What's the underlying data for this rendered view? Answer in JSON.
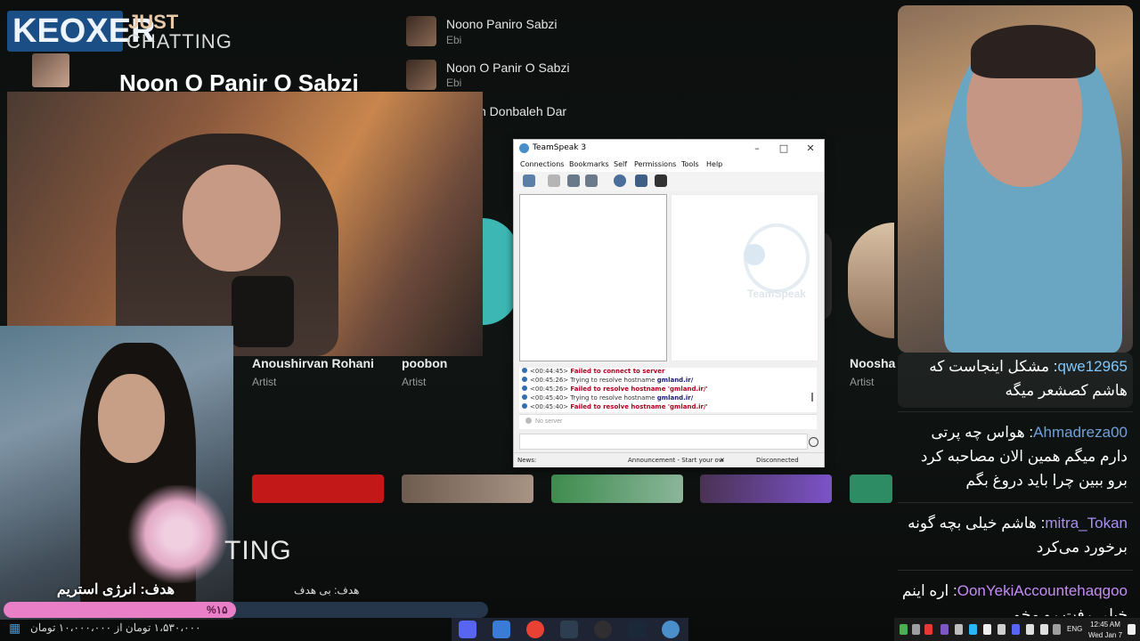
{
  "overlay": {
    "brand": "KEOXER",
    "just_label": "JUST",
    "chatting_label": "CHATTING",
    "chatting_bottom": "TING",
    "playlist_title": "Noon O Panir O Sabzi",
    "goal_left": "هدف: انرژی استریم",
    "goal_mid": "هدف: بی هدف",
    "progress_percent": 15,
    "progress_label": "%۱۵",
    "donate_line": "۱،۵۳۰،۰۰۰ تومان از ۱۰،۰۰۰،۰۰۰ تومان"
  },
  "songs": [
    {
      "title": "Noono Paniro Sabzi",
      "artist": "Ebi"
    },
    {
      "title": "Noon O Panir O Sabzi",
      "artist": "Ebi"
    },
    {
      "title": "h Donbaleh Dar",
      "artist": ""
    }
  ],
  "artists": [
    {
      "name": "Anoushirvan Rohani",
      "role": "Artist"
    },
    {
      "name": "poobon",
      "role": "Artist"
    },
    {
      "name": "Noosha",
      "role": "Artist"
    }
  ],
  "chat": [
    {
      "user": "qwe12965",
      "user_color": "#7ec8ff",
      "message": "مشکل اینجاست که هاشم کصشعر میگه"
    },
    {
      "user": "Ahmadreza00",
      "user_color": "#6fa0d8",
      "message": "هواس چه پرتی دارم میگم همین الان مصاحبه کرد برو ببین چرا باید دروغ بگم"
    },
    {
      "user": "mitra_Tokan",
      "user_color": "#a98ff0",
      "message": "هاشم خیلی بچه گونه برخورد می‌کرد"
    },
    {
      "user": "OonYekiAccountehaqgoo",
      "user_color": "#c58cf5",
      "message": "اره اینم خیلی رفت رو مخم"
    }
  ],
  "teamspeak": {
    "title": "TeamSpeak 3",
    "menu": [
      "Connections",
      "Bookmarks",
      "Self",
      "Permissions",
      "Tools",
      "Help"
    ],
    "toolbar_icons": [
      "connect-icon",
      "disconnect-icon",
      "away-icon",
      "mute-icon",
      "chat-icon",
      "contacts-icon",
      "whisper-icon"
    ],
    "info_watermark": "TeamSpeak",
    "log": [
      {
        "time": "<00:44:45>",
        "text": "Failed to connect to server",
        "type": "error"
      },
      {
        "time": "<00:45:26>",
        "text": "Trying to resolve hostname",
        "host": "gmland.ir/",
        "type": "info"
      },
      {
        "time": "<00:45:26>",
        "text": "Failed to resolve hostname 'gmland.ir/'",
        "type": "error"
      },
      {
        "time": "<00:45:40>",
        "text": "Trying to resolve hostname",
        "host": "gmland.ir/",
        "type": "info"
      },
      {
        "time": "<00:45:40>",
        "text": "Failed to resolve hostname 'gmland.ir/'",
        "type": "error"
      }
    ],
    "server_tab": "No server",
    "status_news": "News:",
    "status_announcement": "Announcement - Start your ow",
    "status_connection": "Disconnected"
  },
  "taskbar": {
    "apps": [
      "discord-icon",
      "files-icon",
      "chrome-icon",
      "app-icon",
      "obs-icon",
      "steam-icon",
      "teamspeak-icon"
    ],
    "language": "ENG",
    "time": "12:45 AM",
    "date": "Wed Jan 7"
  },
  "colors": {
    "brand_blue": "#1c4e86",
    "progress_pink": "#e97fc7",
    "ts_error": "#b00020"
  }
}
